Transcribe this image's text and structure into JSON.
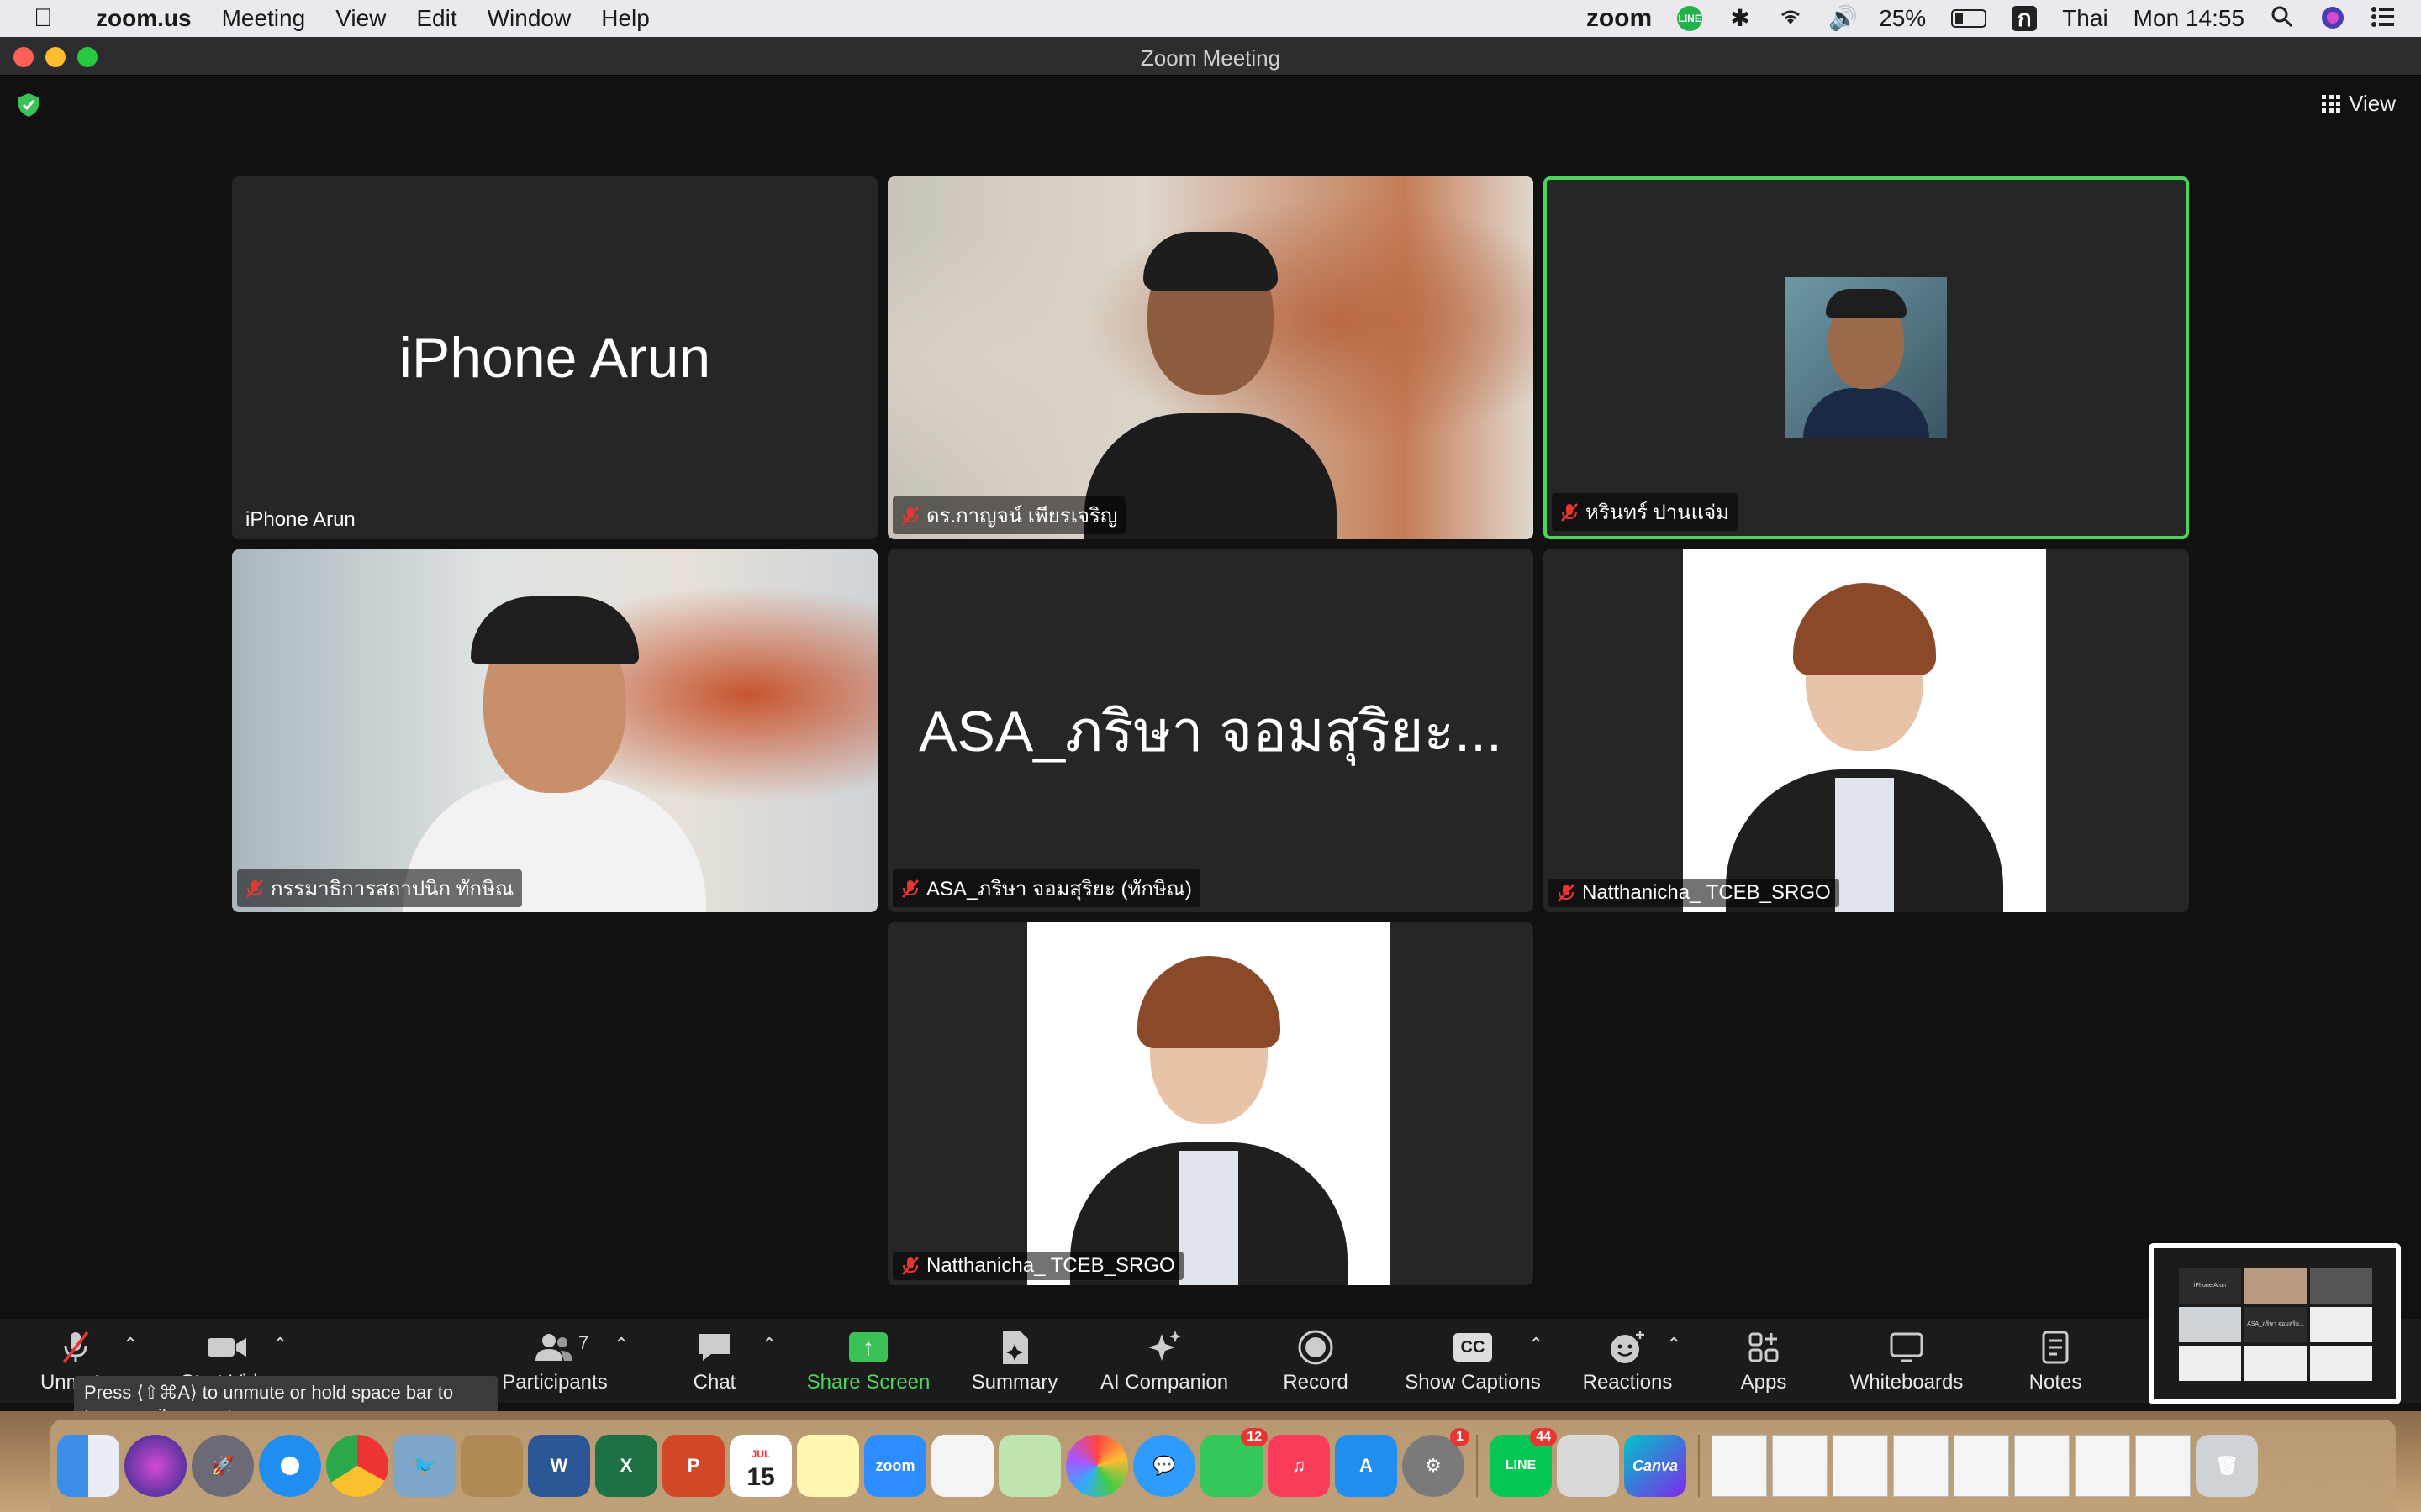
{
  "menubar": {
    "app_name": "zoom.us",
    "menus": [
      "Meeting",
      "View",
      "Edit",
      "Window",
      "Help"
    ],
    "zoom_label": "zoom",
    "battery": "25%",
    "input_source_letter": "ก",
    "input_source": "Thai",
    "clock": "Mon 14:55"
  },
  "window": {
    "title": "Zoom Meeting"
  },
  "meeting": {
    "view_label": "View",
    "tiles": [
      {
        "big_name": "iPhone Arun",
        "name": "iPhone Arun",
        "muted": false
      },
      {
        "name": "ดร.กาญจน์ เพียรเจริญ",
        "muted": true
      },
      {
        "name": "หรินทร์ ปานแจ่ม",
        "muted": true,
        "active": true
      },
      {
        "name": "กรรมาธิการสถาปนิก ทักษิณ",
        "muted": true
      },
      {
        "big_name": "ASA_ภริษา จอมสุริยะ...",
        "name": "ASA_ภริษา จอมสุริยะ (ทักษิณ)",
        "muted": true
      },
      {
        "name": "Natthanicha_ TCEB_SRGO",
        "muted": true
      },
      {
        "name": "Natthanicha_ TCEB_SRGO",
        "muted": true
      }
    ],
    "thumb_labels": {
      "t1": "iPhone Arun",
      "t5": "ASA_ภริษา จอมสุริย..."
    }
  },
  "toolbar": {
    "unmute": "Unmute",
    "video": "Start Video",
    "participants": "Participants",
    "participants_count": "7",
    "chat": "Chat",
    "share": "Share Screen",
    "summary": "Summary",
    "ai": "AI Companion",
    "record": "Record",
    "captions": "Show Captions",
    "captions_icon": "CC",
    "reactions": "Reactions",
    "apps": "Apps",
    "whiteboards": "Whiteboards",
    "notes": "Notes"
  },
  "tooltip": {
    "text": "Press ⟨⇧⌘A⟩ to unmute or hold space bar to temporarily unmute."
  },
  "dock": {
    "badges": {
      "facetime": "12",
      "settings": "1",
      "line": "44"
    },
    "calendar_day": "15",
    "calendar_month": "JUL",
    "word": "W",
    "excel": "X",
    "powerpoint": "P",
    "zoom": "zoom",
    "line": "LINE",
    "canva": "Canva"
  }
}
